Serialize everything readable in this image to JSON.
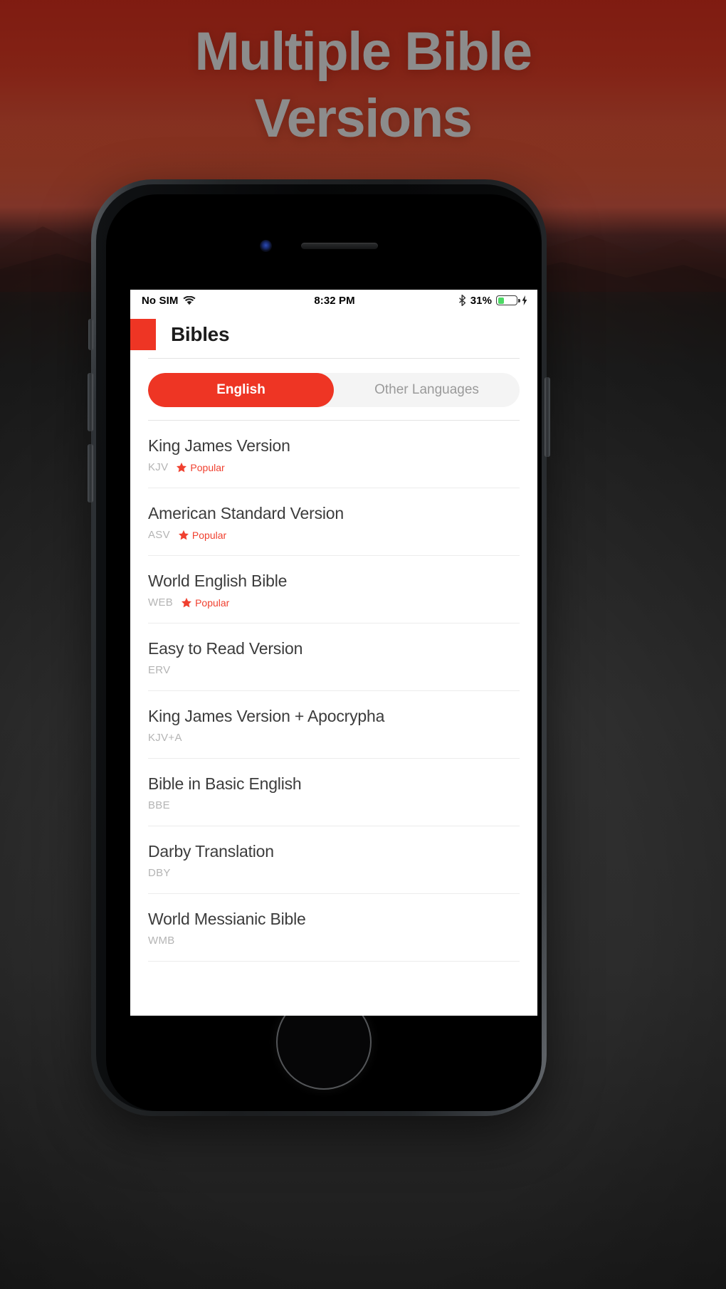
{
  "promo": {
    "headline_line1": "Multiple Bible",
    "headline_line2": "Versions",
    "headline_color": "#ffffff",
    "background_color": "#ee3524"
  },
  "device": {
    "body_color": "#232629",
    "icons": {
      "earpiece": "earpiece-speaker",
      "camera": "front-camera",
      "home": "home-button"
    }
  },
  "status_bar": {
    "carrier": "No SIM",
    "wifi_icon": "wifi-icon",
    "time": "8:32 PM",
    "bluetooth_icon": "bluetooth-icon",
    "battery_percent": "31%",
    "battery_level": 31,
    "battery_color": "#4cd964",
    "charging_icon": "lightning-bolt-icon"
  },
  "navbar": {
    "title": "Bibles",
    "brand_icon": "app-brand-square-icon",
    "brand_color": "#ee3524"
  },
  "segmented": {
    "accent_color": "#ee3524",
    "options": [
      {
        "label": "English",
        "active": true
      },
      {
        "label": "Other Languages",
        "active": false
      }
    ]
  },
  "list": {
    "badge_label": "Popular",
    "badge_icon": "star-icon",
    "badge_color": "#f0402f",
    "items": [
      {
        "title": "King James Version",
        "abbr": "KJV",
        "popular": true
      },
      {
        "title": "American Standard Version",
        "abbr": "ASV",
        "popular": true
      },
      {
        "title": "World English Bible",
        "abbr": "WEB",
        "popular": true
      },
      {
        "title": "Easy to Read Version",
        "abbr": "ERV",
        "popular": false
      },
      {
        "title": "King James Version + Apocrypha",
        "abbr": "KJV+A",
        "popular": false
      },
      {
        "title": "Bible in Basic English",
        "abbr": "BBE",
        "popular": false
      },
      {
        "title": "Darby Translation",
        "abbr": "DBY",
        "popular": false
      },
      {
        "title": "World Messianic Bible",
        "abbr": "WMB",
        "popular": false
      }
    ]
  }
}
